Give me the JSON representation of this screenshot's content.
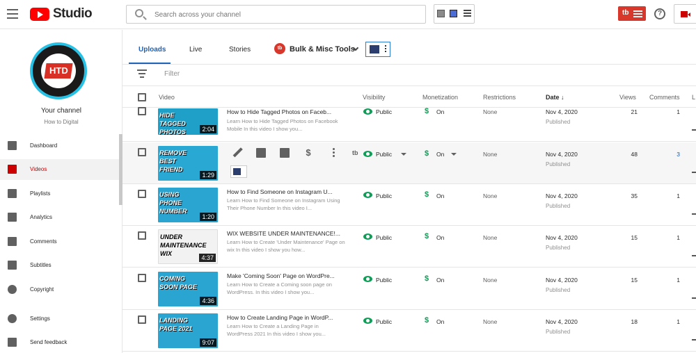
{
  "header": {
    "app_name": "Studio",
    "search_placeholder": "Search across your channel",
    "tubebuddy_label": "tb"
  },
  "sidebar": {
    "channel_label": "Your channel",
    "channel_name": "How to Digital",
    "avatar_text": "HTD",
    "items": [
      {
        "label": "Dashboard",
        "icon": "dashboard-icon"
      },
      {
        "label": "Videos",
        "icon": "videos-icon"
      },
      {
        "label": "Playlists",
        "icon": "playlists-icon"
      },
      {
        "label": "Analytics",
        "icon": "analytics-icon"
      },
      {
        "label": "Comments",
        "icon": "comments-icon"
      },
      {
        "label": "Subtitles",
        "icon": "subtitles-icon"
      },
      {
        "label": "Copyright",
        "icon": "copyright-icon"
      },
      {
        "label": "Settings",
        "icon": "gear-icon"
      },
      {
        "label": "Send feedback",
        "icon": "feedback-icon"
      }
    ]
  },
  "tabs": [
    "Uploads",
    "Live",
    "Stories"
  ],
  "bulk_tools": {
    "icon_text": "tb",
    "label": "Bulk & Misc Tools"
  },
  "filter": {
    "label": "Filter"
  },
  "table": {
    "columns": [
      "Video",
      "Visibility",
      "Monetization",
      "Restrictions",
      "Date",
      "Views",
      "Comments",
      "L"
    ],
    "rows": [
      {
        "thumb_text": "HIDE TAGGED PHOTOS",
        "duration": "2:04",
        "title": "How to Hide Tagged Photos on Faceb...",
        "desc": "Learn How to Hide Tagged Photos on Facebook Mobile In this video I show you...",
        "visibility": "Public",
        "monetization": "On",
        "restrictions": "None",
        "date": "Nov 4, 2020",
        "status": "Published",
        "views": "21",
        "comments": "1"
      },
      {
        "thumb_text": "REMOVE BEST FRIEND",
        "duration": "1:29",
        "title": "",
        "desc": "",
        "visibility": "Public",
        "monetization": "On",
        "restrictions": "None",
        "date": "Nov 4, 2020",
        "status": "Published",
        "views": "48",
        "comments": "3"
      },
      {
        "thumb_text": "USING PHONE NUMBER",
        "duration": "1:20",
        "title": "How to Find Someone on Instagram U...",
        "desc": "Learn How to Find Someone on Instagram Using Their Phone Number In this video I...",
        "visibility": "Public",
        "monetization": "On",
        "restrictions": "None",
        "date": "Nov 4, 2020",
        "status": "Published",
        "views": "35",
        "comments": "1"
      },
      {
        "thumb_text": "UNDER MAINTENANCE WIX",
        "duration": "4:37",
        "title": "WIX WEBSITE UNDER MAINTENANCE!...",
        "desc": "Learn How to Create 'Under Maintenance' Page on wix In this video I show you how...",
        "visibility": "Public",
        "monetization": "On",
        "restrictions": "None",
        "date": "Nov 4, 2020",
        "status": "Published",
        "views": "15",
        "comments": "1"
      },
      {
        "thumb_text": "COMING SOON PAGE",
        "duration": "4:36",
        "title": "Make 'Coming Soon' Page on WordPre...",
        "desc": "Learn How to Create a Coming soon page on WordPress. In this video I show you...",
        "visibility": "Public",
        "monetization": "On",
        "restrictions": "None",
        "date": "Nov 4, 2020",
        "status": "Published",
        "views": "15",
        "comments": "1"
      },
      {
        "thumb_text": "LANDING PAGE 2021",
        "duration": "9:07",
        "title": "How to Create Landing Page in WordP...",
        "desc": "Learn How to Create a Landing Page in WordPress 2021 In this video I show you...",
        "visibility": "Public",
        "monetization": "On",
        "restrictions": "None",
        "date": "Nov 4, 2020",
        "status": "Published",
        "views": "18",
        "comments": "1"
      }
    ]
  },
  "colors": {
    "accent": "#1c62b9",
    "brand_red": "#ff0000",
    "public_green": "#0f9d58",
    "link_blue": "#065fd4"
  }
}
